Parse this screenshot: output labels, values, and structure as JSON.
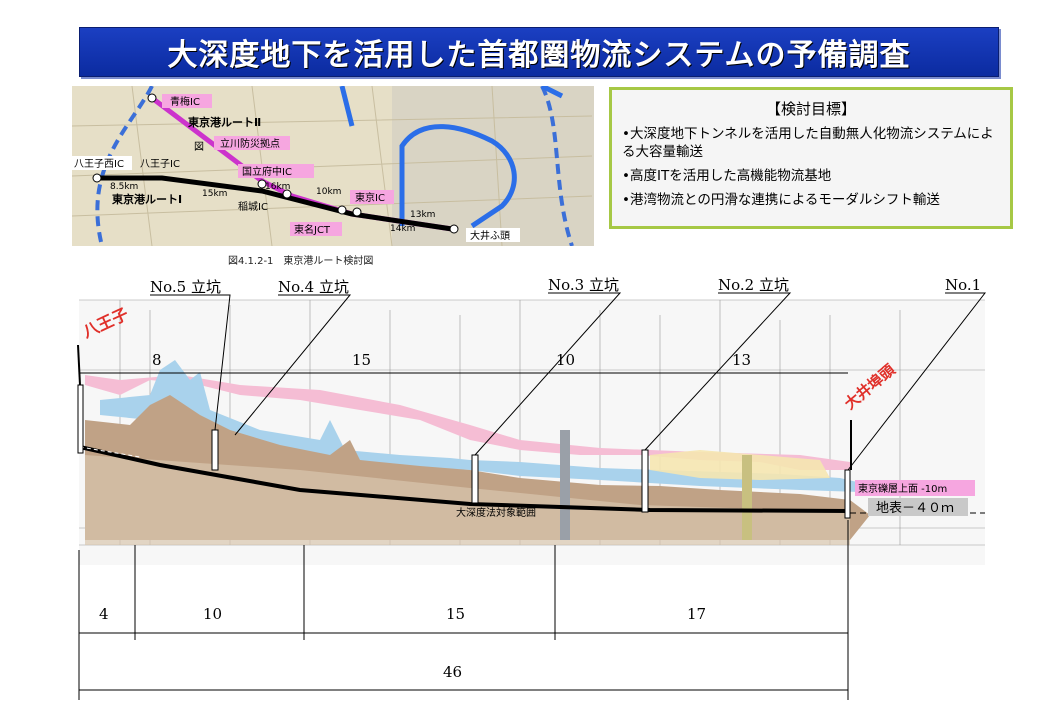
{
  "title": "大深度地下を活用した首都圏物流システムの予備調査",
  "map": {
    "caption": "図4.1.2-1　東京港ルート検討図",
    "labels": {
      "oume_ic": "青梅IC",
      "route2": "東京港ルートⅡ",
      "tachikawa": "立川防災拠点",
      "zu": "図",
      "hachioji_nishi": "八王子西IC",
      "hachioji_ic": "八王子IC",
      "kokuritsu": "国立府中IC",
      "km_8_5": "8.5km",
      "km_15": "15km",
      "km_16": "16km",
      "km_10": "10km",
      "route1": "東京港ルートⅠ",
      "inagi": "稲城IC",
      "tokyo_ic": "東京IC",
      "km_13": "13km",
      "tomei": "東名JCT",
      "km_14": "14km",
      "oi": "大井ふ頭"
    }
  },
  "goals": {
    "title": "【検討目標】",
    "items": [
      "•大深度地下トンネルを活用した自動無人化物流システムによる大容量輸送",
      "•高度ITを活用した高機能物流基地",
      "•港湾物流との円滑な連携によるモーダルシフト輸送"
    ]
  },
  "profile": {
    "shafts": [
      "No.5 立坑",
      "No.4 立坑",
      "No.3 立坑",
      "No.2 立坑",
      "No.1"
    ],
    "hachioji": "八王子",
    "oi_futo": "大井埠頭",
    "segment_top": [
      "8",
      "15",
      "10",
      "13"
    ],
    "range_label": "大深度法対象範囲",
    "gravel_label": "東京礫層上面 -10m",
    "surface_label": "地表－４０ｍ",
    "segment_bottom": [
      "4",
      "10",
      "15",
      "17"
    ],
    "total": "46",
    "colors": {
      "pink": "#f5bdd4",
      "blue": "#a9d2ec",
      "brown": "#c0a286",
      "accent_red": "#e0302a",
      "magenta": "#f6a6e0"
    }
  }
}
